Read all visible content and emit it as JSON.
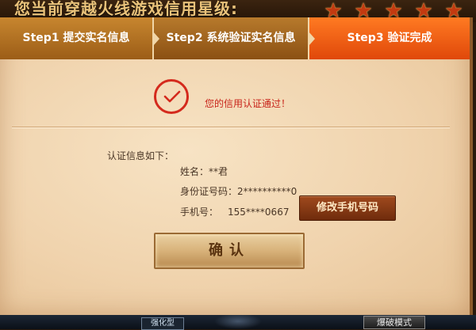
{
  "background": {
    "title": "您当前穿越火线游戏信用星级:",
    "star_count": 5,
    "bottom_left_button": "强化型",
    "bottom_right_button": "爆破模式"
  },
  "steps": [
    {
      "label": "Step1 提交实名信息",
      "active": false
    },
    {
      "label": "Step2 系统验证实名信息",
      "active": false
    },
    {
      "label": "Step3 验证完成",
      "active": true
    }
  ],
  "status": {
    "message": "您的信用认证通过！"
  },
  "info": {
    "title": "认证信息如下：",
    "name_label": "姓名：",
    "name_value": "**君",
    "id_label": "身份证号码：",
    "id_value": "2**********0",
    "phone_label": "手机号：",
    "phone_value": "155****0667"
  },
  "buttons": {
    "change_phone": "修改手机号码",
    "confirm": "确认"
  },
  "colors": {
    "accent_active_step": "#f05a14",
    "success_red": "#d42a1d"
  }
}
